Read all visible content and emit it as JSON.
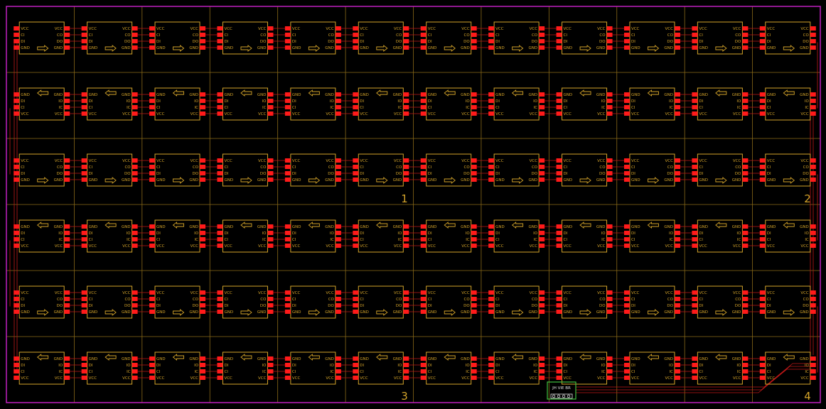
{
  "board": {
    "rows": 6,
    "cols": 12,
    "colors": {
      "background": "#000000",
      "outline": "#c020c0",
      "grid": "#8a6a18",
      "silk": "#d4a42a",
      "pad": "#ff1a1a",
      "trace": "#c01818",
      "connector": "#40c040",
      "connector_label": "#e0e0e0"
    }
  },
  "pin_labels": {
    "forward": [
      "VCC",
      "CI",
      "DI",
      "GND"
    ],
    "forward_right": [
      "VCC",
      "CO",
      "DO",
      "GND"
    ],
    "reverse": [
      "GND",
      "DI",
      "CI",
      "VCC"
    ],
    "reverse_right": [
      "GND",
      "IO",
      "IC",
      "VCC"
    ]
  },
  "direction_icons": {
    "forward": "arrow-right-icon",
    "reverse": "arrow-left-icon"
  },
  "corner_marks": [
    "1",
    "2",
    "3",
    "4"
  ],
  "connector": {
    "label": "JH VIE BR",
    "icon": "header-connector-icon"
  }
}
